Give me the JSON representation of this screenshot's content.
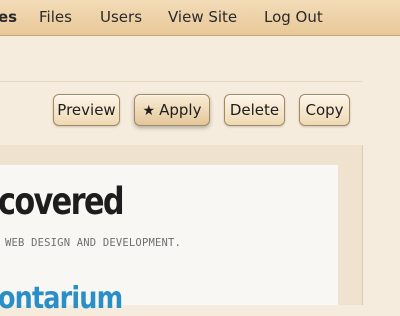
{
  "nav": {
    "items": [
      {
        "label": "es"
      },
      {
        "label": "Files"
      },
      {
        "label": "Users"
      },
      {
        "label": "View Site"
      },
      {
        "label": "Log Out"
      }
    ]
  },
  "toolbar": {
    "preview_label": "Preview",
    "apply_label": "Apply",
    "apply_icon": "star-icon",
    "delete_label": "Delete",
    "copy_label": "Copy"
  },
  "preview": {
    "headline": "covered",
    "tagline": "WEB DESIGN AND DEVELOPMENT.",
    "subheadline": "ontarium"
  },
  "colors": {
    "nav_bg": "#ebcfa4",
    "page_bg": "#f6ecde",
    "subhead": "#2a8fc6"
  }
}
